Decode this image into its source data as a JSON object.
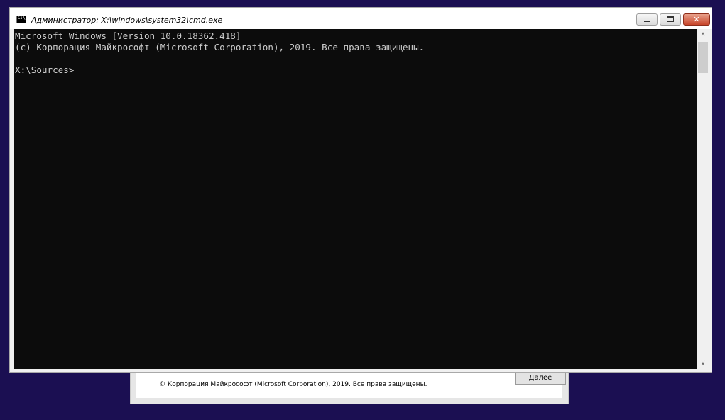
{
  "setup": {
    "copyright": "© Корпорация Майкрософт (Microsoft Corporation), 2019. Все права защищены.",
    "next_button": {
      "accel": "Д",
      "rest": "алее"
    }
  },
  "cmd": {
    "title": "Администратор: X:\\windows\\system32\\cmd.exe",
    "lines": [
      "Microsoft Windows [Version 10.0.18362.418]",
      "(c) Корпорация Майкрософт (Microsoft Corporation), 2019. Все права защищены.",
      "",
      "X:\\Sources>"
    ],
    "icons": {
      "app": "console-icon",
      "minimize": "minimize-icon",
      "maximize": "maximize-icon",
      "close": "close-icon",
      "scroll_up": "chevron-up-icon",
      "scroll_down": "chevron-down-icon"
    }
  },
  "colors": {
    "desktop": "#1b0f52",
    "console_bg": "#0c0c0c",
    "console_text": "#cccccc",
    "close_button": "#c8462b"
  }
}
